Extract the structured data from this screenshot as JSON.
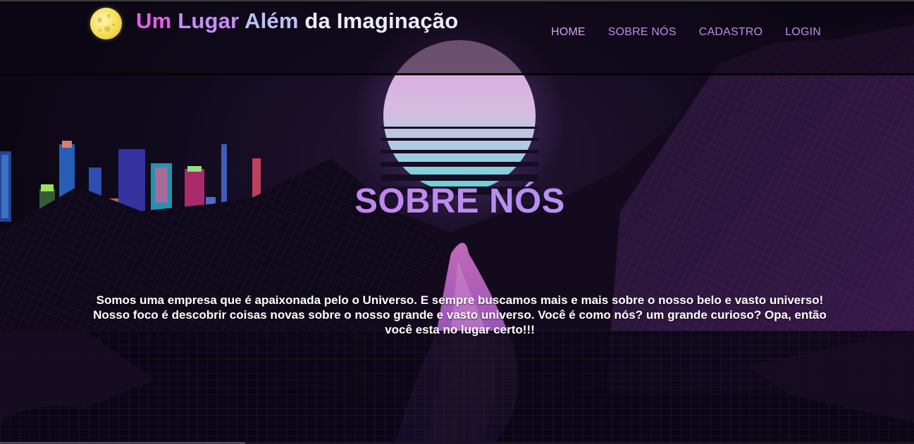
{
  "header": {
    "title_parts": [
      "Um",
      "Lugar",
      "Além",
      "da Imaginação"
    ],
    "logo_icon": "moon-icon",
    "nav": [
      {
        "label": "HOME"
      },
      {
        "label": "SOBRE NÓS"
      },
      {
        "label": "CADASTRO"
      },
      {
        "label": "LOGIN"
      }
    ]
  },
  "hero": {
    "title": "SOBRE NÓS",
    "text": "Somos uma empresa que é apaixonada pelo o Universo. E sempre buscamos mais e mais sobre o nosso belo e vasto universo! Nosso foco é descobrir coisas novas sobre o nosso grande e vasto universo. Você é como nós? um grande curioso? Opa, então você esta no lugar certo!!!"
  },
  "colors": {
    "accent_pink": "#e85ce8",
    "accent_purple": "#c98ef5",
    "accent_lavender": "#b9c3f6",
    "sun_top": "#ffb8ff",
    "sun_bottom": "#6ff0f2",
    "nav_link": "#c58ae8"
  }
}
